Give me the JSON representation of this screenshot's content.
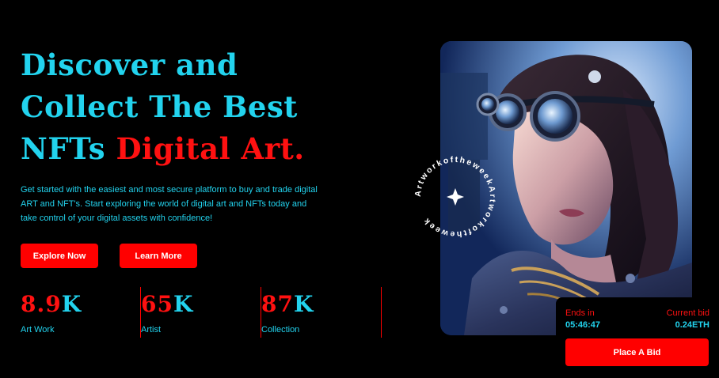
{
  "hero": {
    "title_line1": "Discover and",
    "title_line2": "Collect The Best",
    "title_line3_a": "NFTs ",
    "title_line3_b": "Digital Art.",
    "description": "Get started with the easiest and most secure platform to buy and trade digital ART and NFT's. Start exploring the world of digital art and NFTs today and take control of your digital assets with confidence!",
    "explore_label": "Explore Now",
    "learn_label": "Learn More"
  },
  "stats": [
    {
      "number": "8.9",
      "suffix": "K",
      "label": "Art Work"
    },
    {
      "number": "65",
      "suffix": "K",
      "label": "Artist"
    },
    {
      "number": "87",
      "suffix": "K",
      "label": "Collection"
    }
  ],
  "badge": {
    "text": "ArtworkoftheweekArtworkoftheweek"
  },
  "bid": {
    "ends_label": "Ends in",
    "ends_value": "05:46:47",
    "current_label": "Current bid",
    "current_value": "0.24ETH",
    "place_label": "Place A Bid"
  },
  "colors": {
    "accent_red": "#ff0000",
    "accent_cyan": "#22d3ee",
    "background": "#000000"
  }
}
